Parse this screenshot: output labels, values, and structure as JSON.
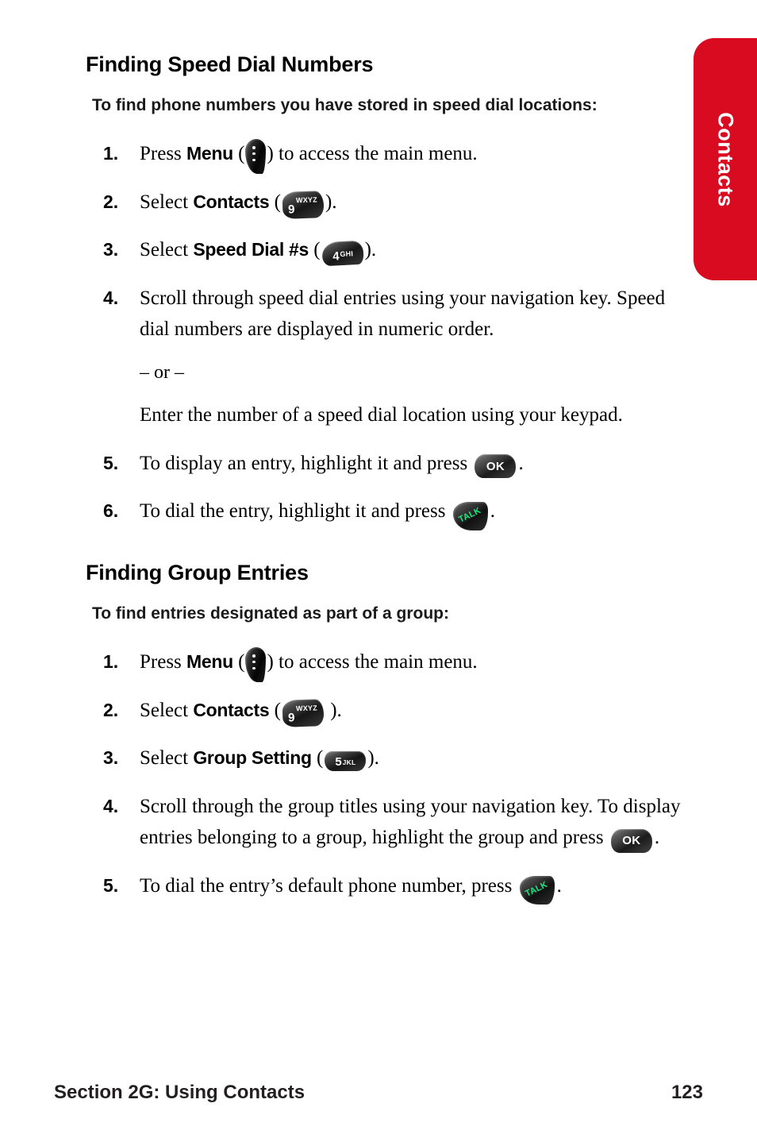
{
  "side_tab": {
    "label": "Contacts",
    "color": "#d90b21"
  },
  "footer": {
    "section": "Section 2G: Using Contacts",
    "page_number": "123"
  },
  "sections": [
    {
      "heading": "Finding Speed Dial Numbers",
      "intro": "To find phone numbers you have stored in speed dial locations:",
      "steps": [
        {
          "num": "1.",
          "pre": "Press ",
          "keyword": "Menu",
          "mid": " (",
          "icon": "menu-key-icon",
          "post": ") to access the main menu."
        },
        {
          "num": "2.",
          "pre": "Select ",
          "keyword": "Contacts",
          "mid": " (",
          "icon": "key-9-wxyz-icon",
          "post": ")."
        },
        {
          "num": "3.",
          "pre": "Select ",
          "keyword": "Speed Dial #s",
          "mid": " (",
          "icon": "key-4-ghi-icon",
          "post": ")."
        },
        {
          "num": "4.",
          "pre": "Scroll through speed dial entries using your navigation key. Speed dial numbers are displayed in numeric order.",
          "or_text": "– or –",
          "extra": "Enter the number of a speed dial location using your keypad."
        },
        {
          "num": "5.",
          "pre": "To display an entry, highlight it and press ",
          "icon": "ok-key-icon",
          "post": "."
        },
        {
          "num": "6.",
          "pre": "To dial the entry, highlight it and press ",
          "icon": "talk-key-icon",
          "post": "."
        }
      ]
    },
    {
      "heading": "Finding Group Entries",
      "intro": "To find entries designated as part of a group:",
      "steps": [
        {
          "num": "1.",
          "pre": "Press ",
          "keyword": "Menu",
          "mid": " (",
          "icon": "menu-key-icon",
          "post": ") to access the main menu."
        },
        {
          "num": "2.",
          "pre": "Select ",
          "keyword": "Contacts",
          "mid": " (",
          "icon": "key-9-wxyz-icon",
          "post": " )."
        },
        {
          "num": "3.",
          "pre": "Select ",
          "keyword": "Group Setting",
          "mid": " (",
          "icon": "key-5-jkl-icon",
          "post": ")."
        },
        {
          "num": "4.",
          "pre": "Scroll through the group titles using your navigation key. To display entries belonging to a group, highlight the group and press ",
          "icon": "ok-key-icon",
          "post": "."
        },
        {
          "num": "5.",
          "pre": "To dial the entry’s default phone number, press ",
          "icon": "talk-key-icon",
          "post": "."
        }
      ]
    }
  ],
  "icons": {
    "key_9": {
      "digit": "9",
      "letters": "WXYZ"
    },
    "key_4": {
      "digit": "4",
      "letters": "GHI"
    },
    "key_5": {
      "digit": "5",
      "letters": "JKL"
    },
    "ok": {
      "label": "OK"
    },
    "talk": {
      "label": "TALK",
      "color": "#22e27f"
    }
  }
}
